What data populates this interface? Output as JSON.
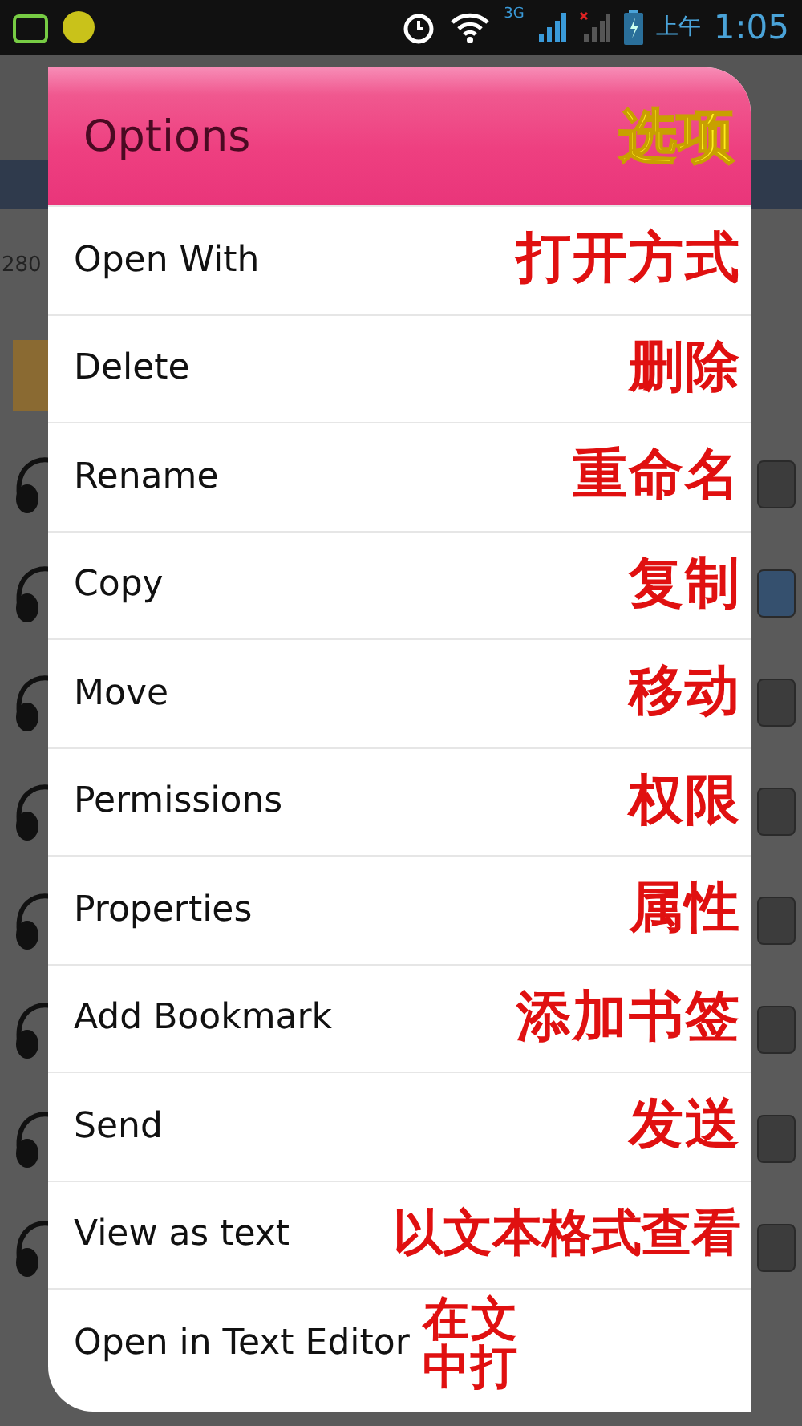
{
  "status_bar": {
    "network": "3G",
    "period": "上午",
    "time": "1:05"
  },
  "background": {
    "count": "280",
    "rows": [
      {
        "kind": "folder"
      },
      {
        "kind": "audio",
        "checked": false
      },
      {
        "kind": "audio",
        "checked": true
      },
      {
        "kind": "audio",
        "checked": false
      },
      {
        "kind": "audio",
        "checked": false
      },
      {
        "kind": "audio",
        "checked": false
      },
      {
        "kind": "audio",
        "checked": false
      },
      {
        "kind": "audio",
        "checked": false
      },
      {
        "kind": "audio",
        "checked": false
      }
    ]
  },
  "dialog": {
    "title": "Options",
    "title_note": "选项",
    "items": [
      {
        "label": "Open With",
        "note": [
          "打开方式"
        ]
      },
      {
        "label": "Delete",
        "note": [
          "删除"
        ]
      },
      {
        "label": "Rename",
        "note": [
          "重命名"
        ]
      },
      {
        "label": "Copy",
        "note": [
          "复制"
        ]
      },
      {
        "label": "Move",
        "note": [
          "移动"
        ]
      },
      {
        "label": "Permissions",
        "note": [
          "权限"
        ]
      },
      {
        "label": "Properties",
        "note": [
          "属性"
        ]
      },
      {
        "label": "Add Bookmark",
        "note": [
          "添加书签"
        ]
      },
      {
        "label": "Send",
        "note": [
          "发送"
        ]
      },
      {
        "label": "View as text",
        "note": [
          "以文本格式查看"
        ]
      },
      {
        "label": "Open in Text Editor",
        "note": [
          "在文",
          "中打"
        ]
      }
    ]
  }
}
